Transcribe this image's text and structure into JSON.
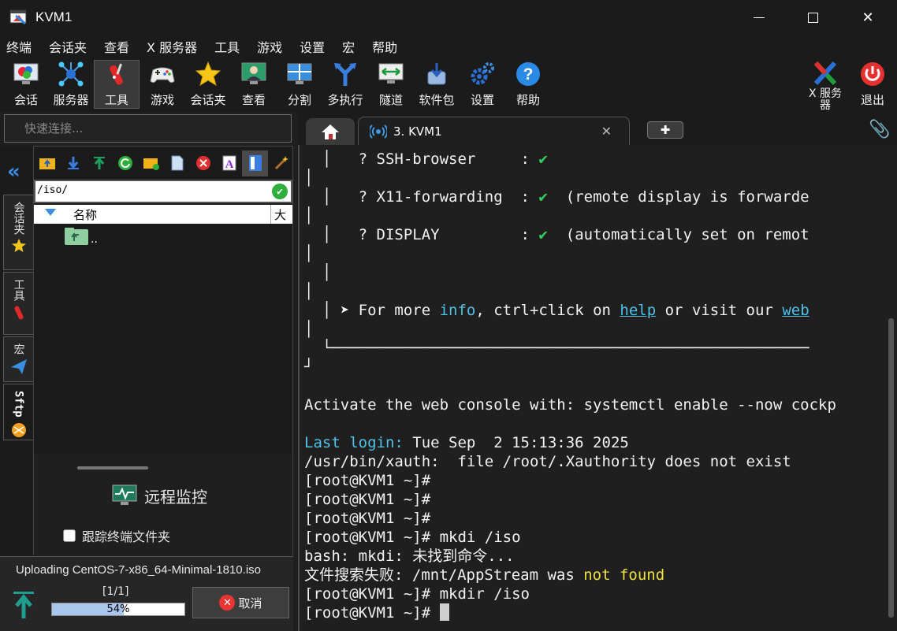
{
  "window": {
    "title": "KVM1"
  },
  "menu": [
    "终端",
    "会话夹",
    "查看",
    "X 服务器",
    "工具",
    "游戏",
    "设置",
    "宏",
    "帮助"
  ],
  "toolbar": {
    "session": "会话",
    "servers": "服务器",
    "tools": "工具",
    "games": "游戏",
    "sessions_folder": "会话夹",
    "view": "查看",
    "split": "分割",
    "multiexec": "多执行",
    "tunnel": "隧道",
    "packages": "软件包",
    "settings": "设置",
    "help": "帮助",
    "xserver": "X 服务\n器",
    "exit": "退出"
  },
  "quick_connect": {
    "placeholder": "快速连接..."
  },
  "tabs": {
    "active": "3. KVM1"
  },
  "side_tabs": {
    "sessions": "会话夹",
    "tools": "工具",
    "macros": "宏",
    "sftp": "Sftp"
  },
  "sftp": {
    "path": "/iso/",
    "col_name": "名称",
    "col_size": "大小",
    "parent": "..",
    "remote_monitor": "远程监控",
    "follow_terminal": "跟踪终端文件夹"
  },
  "upload": {
    "title": "Uploading CentOS-7-x86_64-Minimal-1810.iso",
    "count": "[1/1]",
    "progress": 54,
    "progress_label": "54%",
    "cancel": "取消"
  },
  "terminal": {
    "l1a": "  │   ? SSH-browser     : ",
    "l1b": "✔",
    "l2": "│",
    "l3a": "  │   ? X11-forwarding  : ",
    "l3b": "✔",
    "l3c": "  (remote display is forwarde",
    "l4": "│",
    "l5a": "  │   ? DISPLAY         : ",
    "l5b": "✔",
    "l5c": "  (automatically set on remot",
    "l6": "│",
    "l7": "  │",
    "l8": "│",
    "l9a": "  │ ➤ For more ",
    "l9b": "info",
    "l9c": ", ctrl+click on ",
    "l9d": "help",
    "l9e": " or visit our ",
    "l9f": "web",
    "l10": "│",
    "l11": "  └─────────────────────────────────────────────────────",
    "l12": "┘",
    "l13": "Activate the web console with: systemctl enable --now cockp",
    "l14a": "Last login:",
    "l14b": " Tue Sep  2 15:13:36 2025",
    "l15": "/usr/bin/xauth:  file /root/.Xauthority does not exist",
    "l16": "[root@KVM1 ~]#",
    "l17": "[root@KVM1 ~]#",
    "l18": "[root@KVM1 ~]#",
    "l19": "[root@KVM1 ~]# mkdi /iso",
    "l20": "bash: mkdi: 未找到命令...",
    "l21a": "文件搜索失败: /mnt/AppStream was ",
    "l21b": "not found",
    "l22": "[root@KVM1 ~]# mkdir /iso",
    "l23": "[root@KVM1 ~]# "
  },
  "colors": {
    "accent": "#3c8de6",
    "terminal_bg": "#1f1f1f",
    "check_green": "#33d45a",
    "link_cyan": "#4ec2e8",
    "warn_yellow": "#f0e040"
  }
}
